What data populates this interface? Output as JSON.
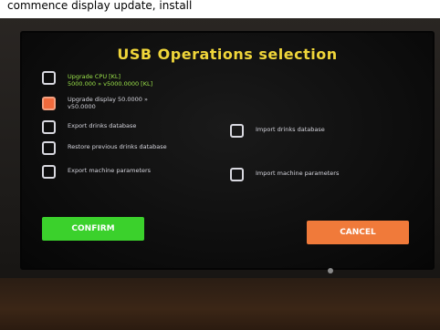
{
  "caption": "commence display update, install",
  "screen": {
    "title": "USB Operations selection",
    "options": {
      "upgrade_cpu": "Upgrade CPU [KL]\n5000.000 » v5000.0000 [KL]",
      "upgrade_display": "Upgrade display 50.0000 »\nv50.0000",
      "export_drinks": "Export drinks database",
      "import_drinks": "Import drinks database",
      "restore_drinks": "Restore previous drinks database",
      "export_params": "Export machine parameters",
      "import_params": "Import machine parameters"
    },
    "confirm_label": "CONFIRM",
    "cancel_label": "CANCEL"
  },
  "colors": {
    "title": "#f0d63a",
    "confirm": "#3bd12c",
    "cancel": "#f07a3a",
    "checked": "#f06a3c",
    "highlight_text": "#9be34a"
  }
}
